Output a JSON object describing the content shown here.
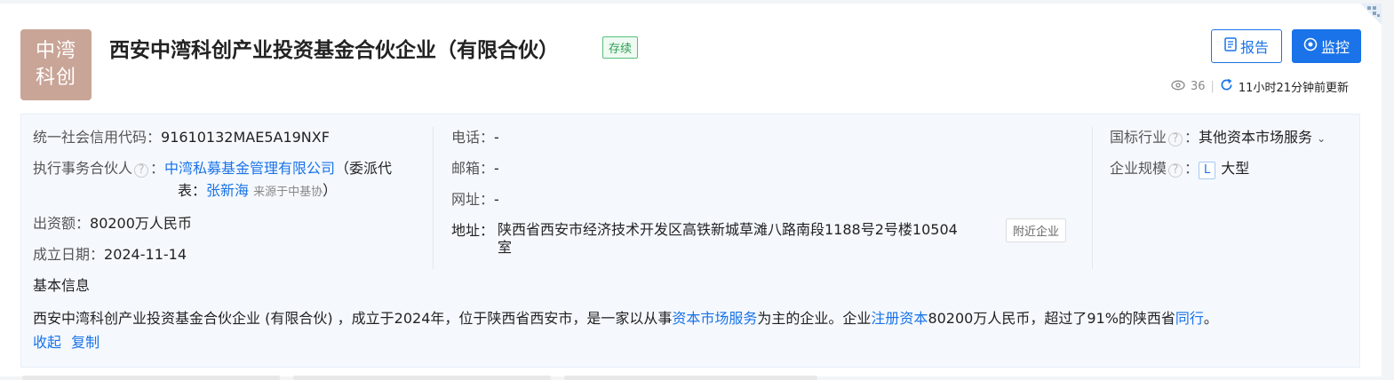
{
  "logo": {
    "line1": "中湾",
    "line2": "科创"
  },
  "company": {
    "name": "西安中湾科创产业投资基金合伙企业（有限合伙）",
    "status": "存续"
  },
  "actions": {
    "report_label": "报告",
    "monitor_label": "监控"
  },
  "meta": {
    "views": "36",
    "updated": "11小时21分钟前更新"
  },
  "info": {
    "credit_code_label": "统一社会信用代码：",
    "credit_code": "91610132MAE5A19NXF",
    "partner_label": "执行事务合伙人",
    "partner_colon": "：",
    "partner_name": "中湾私募基金管理有限公司",
    "partner_rep_prefix": "（委派代",
    "partner_rep_prefix2": "表：",
    "partner_rep_name": "张新海",
    "partner_rep_source": "来源于中基协",
    "partner_rep_suffix": "）",
    "capital_label": "出资额：",
    "capital": "80200万人民币",
    "founded_label": "成立日期：",
    "founded": "2024-11-14",
    "phone_label": "电话：",
    "phone": "-",
    "email_label": "邮箱：",
    "email": "-",
    "website_label": "网址：",
    "website": "-",
    "address_label": "地址：",
    "address_line1": "陕西省西安市经济技术开发区高铁新城草滩八路南段1188号2号楼10504",
    "address_line2": "室",
    "nearby_label": "附近企业",
    "industry_label": "国标行业",
    "industry_colon": "：",
    "industry": "其他资本市场服务",
    "scale_label": "企业规模",
    "scale_colon": "：",
    "scale_badge": "L",
    "scale": "大型"
  },
  "basic": {
    "title": "基本信息",
    "text1": "西安中湾科创产业投资基金合伙企业 (有限合伙) ，成立于2024年，位于陕西省西安市，是一家以从事",
    "link1": "资本市场服务",
    "text2": "为主的企业。企业",
    "link2": "注册资本",
    "text3": "80200万人民币，超过了91%的陕西省",
    "link3": "同行",
    "text4": "。",
    "collapse": "收起",
    "copy": "复制"
  }
}
